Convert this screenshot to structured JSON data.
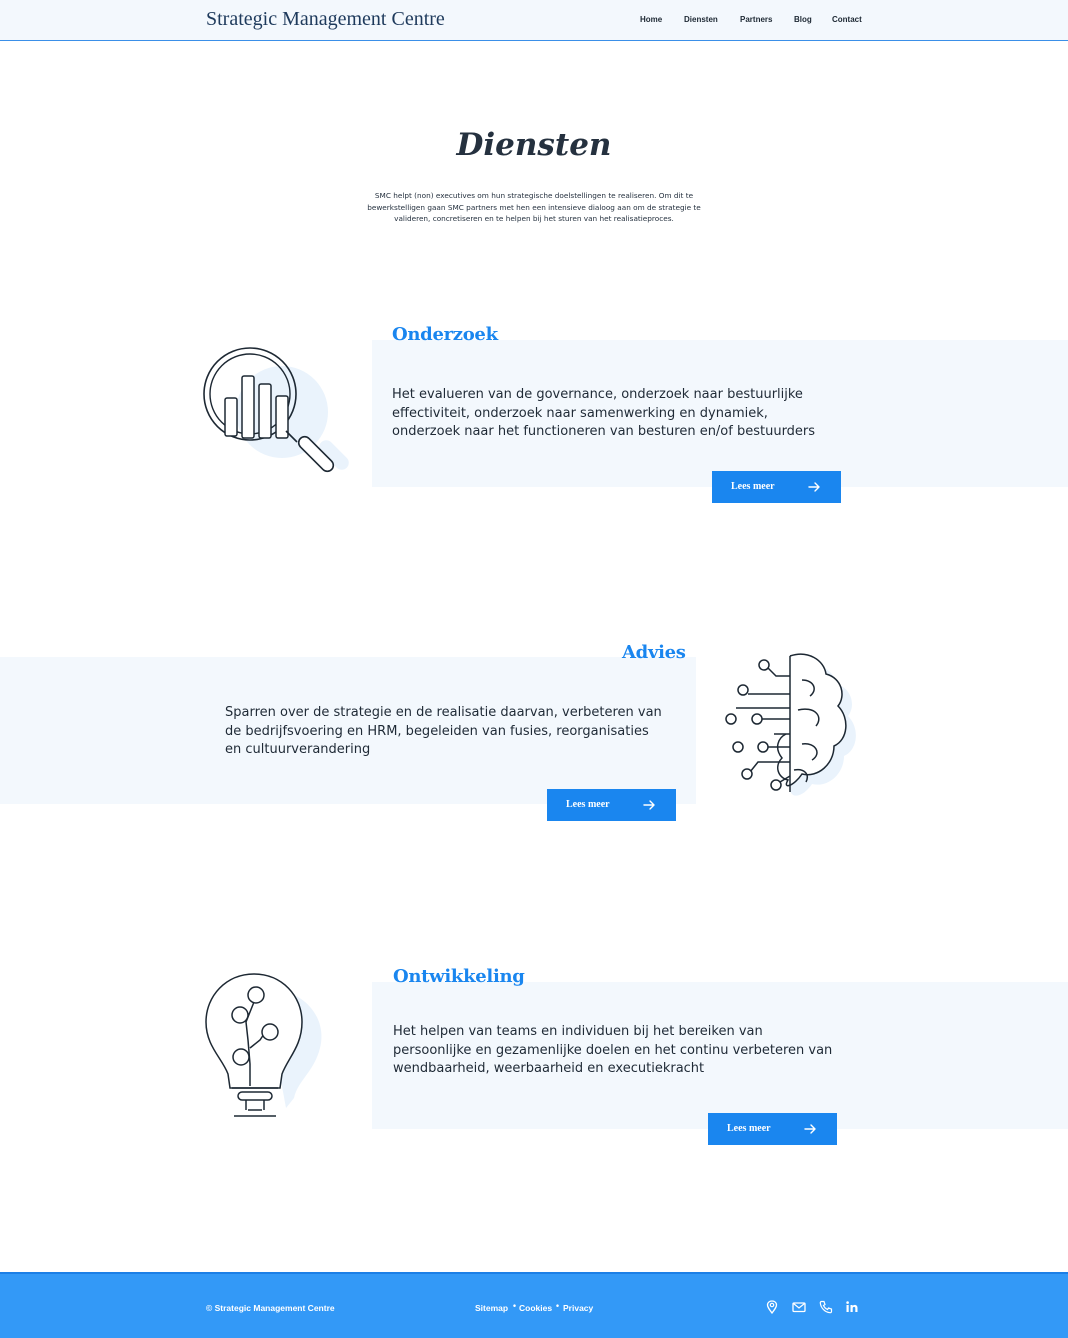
{
  "header": {
    "brand": "Strategic Management Centre",
    "nav": [
      "Home",
      "Diensten",
      "Partners",
      "Blog",
      "Contact"
    ]
  },
  "intro": {
    "title": "Diensten",
    "text": "SMC helpt (non) executives om hun strategische doelstellingen te realiseren. Om dit te bewerkstelligen gaan SMC partners met hen een intensieve dialoog aan om de strategie te valideren, concretiseren en te helpen bij het sturen van het realisatieproces."
  },
  "services": [
    {
      "title": "Onderzoek",
      "text": "Het evalueren van de governance, onderzoek naar bestuurlijke effectiviteit, onderzoek naar samenwerking en dynamiek, onderzoek naar het functioneren van besturen en/of bestuurders",
      "button": "Lees meer",
      "icon": "magnifier-chart-icon"
    },
    {
      "title": "Advies",
      "text": "Sparren over de strategie en de realisatie daarvan, verbeteren van de bedrijfsvoering en HRM, begeleiden van fusies, reorganisaties en cultuurverandering",
      "button": "Lees meer",
      "icon": "brain-circuit-icon"
    },
    {
      "title": "Ontwikkeling",
      "text": "Het helpen van teams en individuen bij het bereiken van persoonlijke en gezamenlijke doelen en het continu verbeteren van wendbaarheid, weerbaarheid en executiekracht",
      "button": "Lees meer",
      "icon": "lightbulb-tree-icon"
    }
  ],
  "footer": {
    "copyright": "© Strategic Management Centre",
    "links": [
      "Sitemap",
      "Cookies",
      "Privacy"
    ],
    "separator": "•",
    "icons": [
      "location-icon",
      "mail-icon",
      "phone-icon",
      "linkedin-icon"
    ]
  },
  "colors": {
    "accent": "#1a86ef",
    "footer": "#3399f7",
    "panel": "#f3f8fd",
    "text": "#1d2833"
  }
}
